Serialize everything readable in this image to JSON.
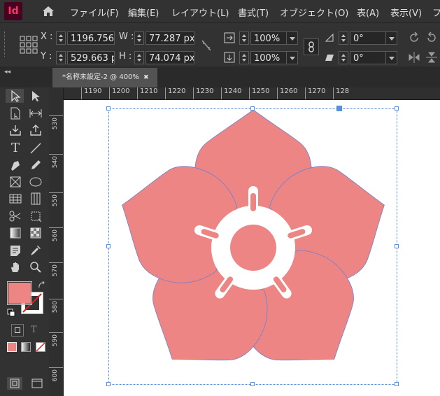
{
  "app": {
    "logo": "Id",
    "home_icon": "home-icon"
  },
  "menu": [
    "ファイル(F)",
    "編集(E)",
    "レイアウト(L)",
    "書式(T)",
    "オブジェクト(O)",
    "表(A)",
    "表示(V)",
    "フ"
  ],
  "control": {
    "x_label": "X :",
    "x_value": "1196.756 p",
    "y_label": "Y :",
    "y_value": "529.663 px",
    "w_label": "W :",
    "w_value": "77.287 px",
    "h_label": "H :",
    "h_value": "74.074 px",
    "scale_x": "100%",
    "scale_y": "100%",
    "rotate": "0°",
    "shear": "0°"
  },
  "tab": {
    "title": "*名称未設定-2 @ 400%",
    "close": "✖"
  },
  "ruler": {
    "h_ticks": [
      "1190",
      "1200",
      "1210",
      "1220",
      "1230",
      "1240",
      "1250",
      "1260",
      "1270",
      "128"
    ],
    "v_ticks": [
      "530",
      "540",
      "550",
      "560",
      "570",
      "580",
      "590",
      "600"
    ]
  },
  "colors": {
    "fill": "#ee8585",
    "selection": "#5a8fe0",
    "panel": "#323232"
  },
  "tools": [
    "selection-tool",
    "direct-selection-tool",
    "page-tool",
    "gap-tool",
    "content-collector-tool",
    "content-placer-tool",
    "type-tool",
    "line-tool",
    "pen-tool",
    "pencil-tool",
    "rectangle-frame-tool",
    "ellipse-tool",
    "table-tool",
    "grid-tool",
    "scissors-tool",
    "free-transform-tool",
    "gradient-tool",
    "gradient-feather-tool",
    "note-tool",
    "eyedropper-tool",
    "hand-tool",
    "zoom-tool"
  ],
  "toolbox_text": {
    "type_glyph": "T",
    "text_t": "T"
  }
}
